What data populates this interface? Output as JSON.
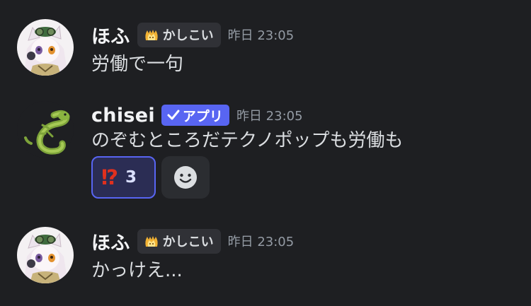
{
  "messages": [
    {
      "username": "ほふ",
      "tag": "かしこい",
      "timestamp": "昨日 23:05",
      "text": "労働で一句",
      "avatar": "anime-character-avatar-icon"
    },
    {
      "username": "chisei",
      "app_badge": "アプリ",
      "timestamp": "昨日 23:05",
      "text": "のぞむところだテクノポップも労働も",
      "avatar": "lizard-avatar-icon",
      "reactions": [
        {
          "emoji": "⁉",
          "count": "3"
        }
      ]
    },
    {
      "username": "ほふ",
      "tag": "かしこい",
      "timestamp": "昨日 23:05",
      "text": "かっけえ...",
      "avatar": "anime-character-avatar-icon"
    }
  ],
  "colors": {
    "background": "#1e1f22",
    "username": "#f2f3f5",
    "timestamp": "#949ba4",
    "app_badge": "#5865f2",
    "reaction_border": "#5865f2",
    "reaction_emoji": "#e0301e"
  }
}
